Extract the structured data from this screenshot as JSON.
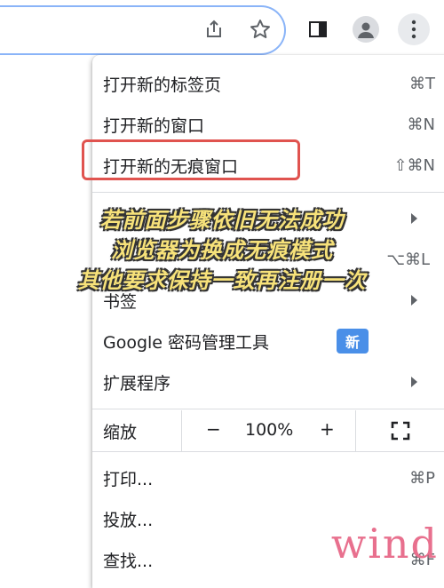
{
  "toolbar": {
    "icons": [
      "share-icon",
      "star-icon",
      "side-panel-icon",
      "profile-icon",
      "more-menu-icon"
    ]
  },
  "menu": {
    "items": [
      {
        "label": "打开新的标签页",
        "shortcut": "⌘T"
      },
      {
        "label": "打开新的窗口",
        "shortcut": "⌘N"
      },
      {
        "label": "打开新的无痕窗口",
        "shortcut": "⇧⌘N"
      },
      {
        "label": "",
        "shortcut": "⌥⌘L"
      },
      {
        "label": "书签"
      },
      {
        "label": "Google 密码管理工具",
        "badge": "新"
      },
      {
        "label": "扩展程序"
      },
      {
        "label": "打印...",
        "shortcut": "⌘P"
      },
      {
        "label": "投放..."
      },
      {
        "label": "查找...",
        "shortcut": "⌘F"
      }
    ],
    "zoom": {
      "label": "缩放",
      "minus": "−",
      "value": "100%",
      "plus": "+"
    }
  },
  "overlay": {
    "lines": [
      "若前面步骤依旧无法成功",
      "浏览器为换成无痕模式",
      "其他要求保持一致再注册一次"
    ]
  },
  "watermark": "wind",
  "colors": {
    "highlight": "#e0534f",
    "badge": "#4a8fe8",
    "caption": "#f7e27a",
    "watermark": "#e8708e"
  }
}
